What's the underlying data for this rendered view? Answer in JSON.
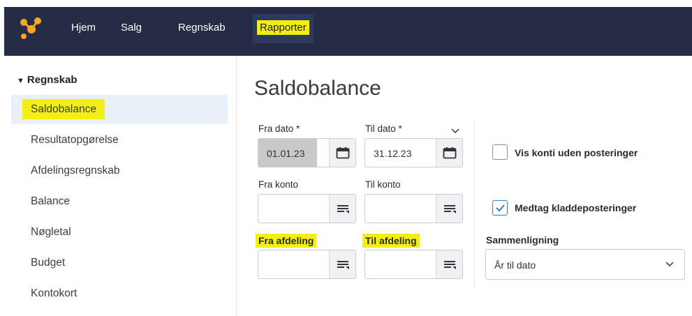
{
  "nav": {
    "items": [
      "Hjem",
      "Salg",
      "Regnskab",
      "Rapporter"
    ],
    "active": "Rapporter"
  },
  "sidebar": {
    "section": "Regnskab",
    "items": [
      "Saldobalance",
      "Resultatopgørelse",
      "Afdelingsregnskab",
      "Balance",
      "Nøgletal",
      "Budget",
      "Kontokort"
    ],
    "selected": "Saldobalance"
  },
  "main": {
    "title": "Saldobalance",
    "fra_dato": {
      "label": "Fra dato *",
      "value": "01.01.23"
    },
    "til_dato": {
      "label": "Til dato *",
      "value": "31.12.23"
    },
    "fra_konto": {
      "label": "Fra konto",
      "value": ""
    },
    "til_konto": {
      "label": "Til konto",
      "value": ""
    },
    "fra_afdeling": {
      "label": "Fra afdeling",
      "value": ""
    },
    "til_afdeling": {
      "label": "Til afdeling",
      "value": ""
    },
    "vis_konti": {
      "label": "Vis konti uden posteringer",
      "checked": false
    },
    "medtag": {
      "label": "Medtag kladdeposteringer",
      "checked": true
    },
    "sammenligning": {
      "label": "Sammenligning",
      "value": "År til dato"
    }
  },
  "colors": {
    "topbar": "#262b46",
    "highlight": "#f3ef16",
    "accent": "#3b7fd0"
  }
}
